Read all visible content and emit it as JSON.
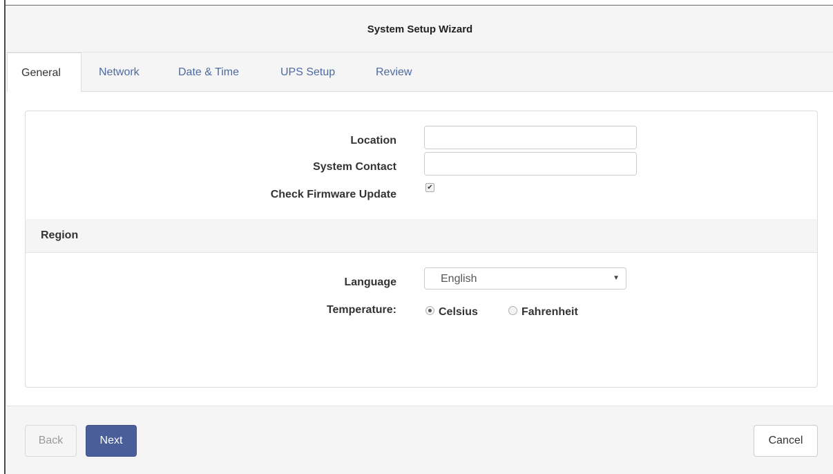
{
  "wizard": {
    "title": "System Setup Wizard"
  },
  "tabs": [
    {
      "label": "General",
      "active": true
    },
    {
      "label": "Network",
      "active": false
    },
    {
      "label": "Date & Time",
      "active": false
    },
    {
      "label": "UPS Setup",
      "active": false
    },
    {
      "label": "Review",
      "active": false
    }
  ],
  "general": {
    "location_label": "Location",
    "location_value": "",
    "contact_label": "System Contact",
    "contact_value": "",
    "firmware_label": "Check Firmware Update",
    "firmware_checked": true
  },
  "region": {
    "header": "Region",
    "language_label": "Language",
    "language_value": "English",
    "temperature_label": "Temperature:",
    "temperature_options": [
      {
        "label": "Celsius",
        "selected": true
      },
      {
        "label": "Fahrenheit",
        "selected": false
      }
    ]
  },
  "footer": {
    "back_label": "Back",
    "next_label": "Next",
    "cancel_label": "Cancel"
  },
  "colors": {
    "primary_button": "#4a5f99",
    "tab_link": "#4d6aa0",
    "background": "#f5f5f5"
  }
}
